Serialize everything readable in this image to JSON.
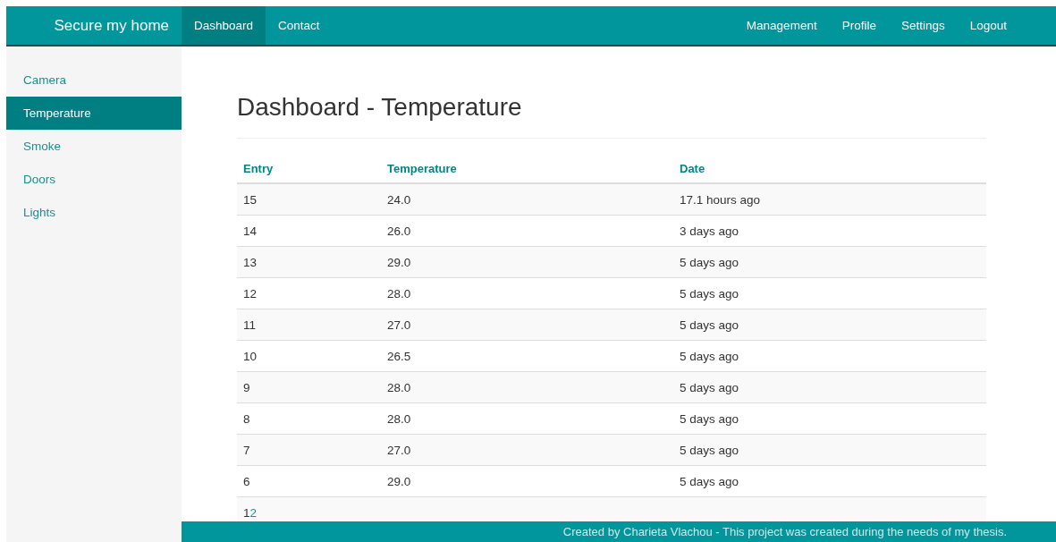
{
  "navbar": {
    "brand": "Secure my home",
    "left_links": [
      {
        "label": "Dashboard",
        "selected": true
      },
      {
        "label": "Contact",
        "selected": false
      }
    ],
    "right_links": [
      {
        "label": "Management"
      },
      {
        "label": "Profile"
      },
      {
        "label": "Settings"
      },
      {
        "label": "Logout"
      }
    ]
  },
  "sidebar": {
    "items": [
      {
        "label": "Camera",
        "selected": false
      },
      {
        "label": "Temperature",
        "selected": true
      },
      {
        "label": "Smoke",
        "selected": false
      },
      {
        "label": "Doors",
        "selected": false
      },
      {
        "label": "Lights",
        "selected": false
      }
    ]
  },
  "page_title": "Dashboard - Temperature",
  "table": {
    "columns": [
      "Entry",
      "Temperature",
      "Date"
    ],
    "rows": [
      [
        "15",
        "24.0",
        "17.1 hours ago"
      ],
      [
        "14",
        "26.0",
        "3 days ago"
      ],
      [
        "13",
        "29.0",
        "5 days ago"
      ],
      [
        "12",
        "28.0",
        "5 days ago"
      ],
      [
        "11",
        "27.0",
        "5 days ago"
      ],
      [
        "10",
        "26.5",
        "5 days ago"
      ],
      [
        "9",
        "28.0",
        "5 days ago"
      ],
      [
        "8",
        "28.0",
        "5 days ago"
      ],
      [
        "7",
        "27.0",
        "5 days ago"
      ],
      [
        "6",
        "29.0",
        "5 days ago"
      ]
    ]
  },
  "pagination": [
    {
      "label": "1",
      "selected": true
    },
    {
      "label": "2",
      "selected": false
    }
  ],
  "footer": "Created by Charieta Vlachou - This project was created during the needs of my thesis."
}
